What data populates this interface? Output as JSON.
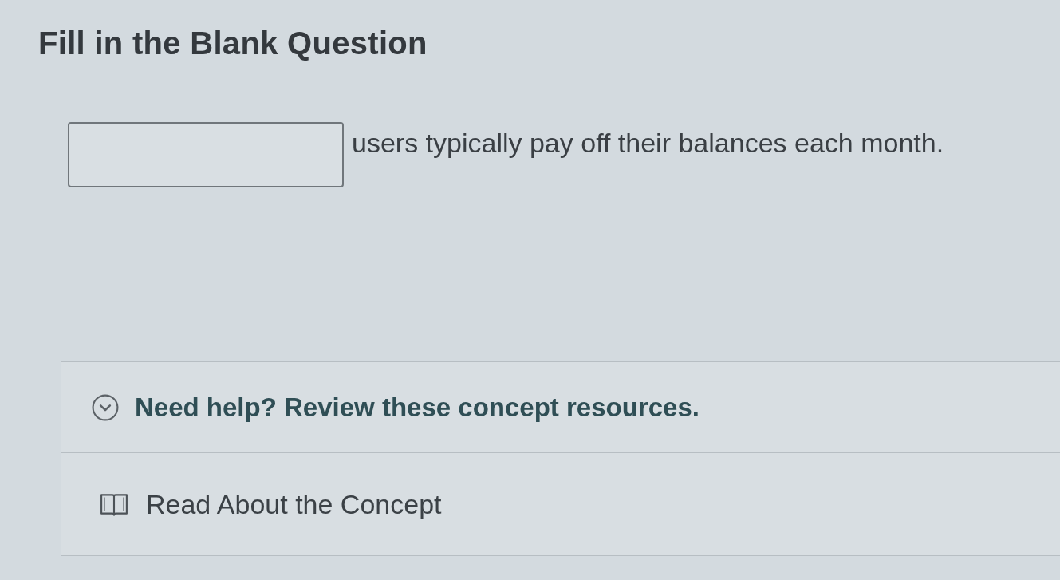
{
  "page": {
    "title": "Fill in the Blank Question"
  },
  "question": {
    "parts": [
      {
        "kind": "blank"
      },
      {
        "kind": "text",
        "text": "users typically pay off their balances each month."
      }
    ]
  },
  "help": {
    "heading": "Need help? Review these concept resources.",
    "expanded": true,
    "resources": [
      {
        "kind": "reading",
        "label": "Read About the Concept"
      }
    ]
  }
}
